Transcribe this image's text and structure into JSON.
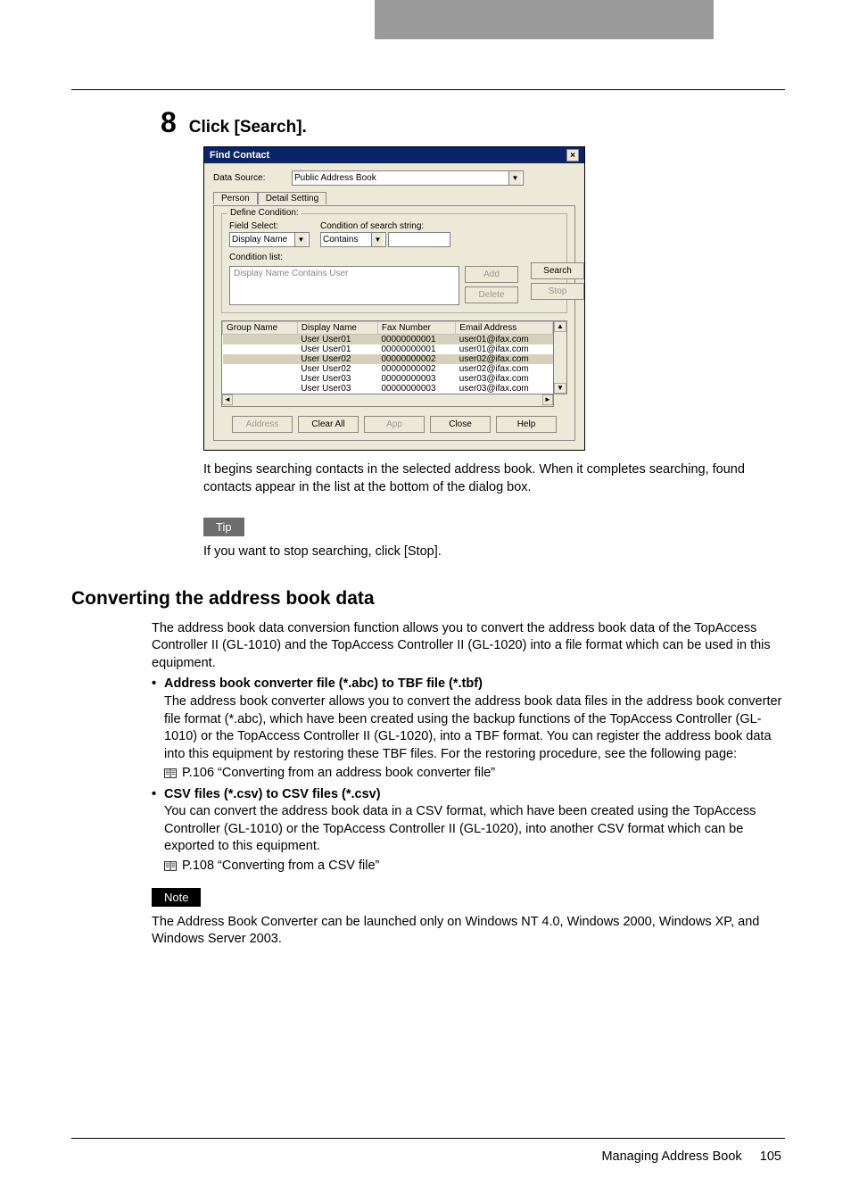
{
  "step": {
    "number": "8",
    "title": "Click [Search]."
  },
  "dialog": {
    "title": "Find Contact",
    "data_source_label": "Data Source:",
    "data_source_value": "Public Address Book",
    "tabs": {
      "person": "Person",
      "detail": "Detail Setting"
    },
    "fieldset_label": "Define Condition:",
    "field_select_label": "Field Select:",
    "field_select_value": "Display Name",
    "cond_label": "Condition of search string:",
    "cond_value": "Contains",
    "cond_list_label": "Condition list:",
    "cond_list_item": "Display Name Contains User",
    "buttons": {
      "add": "Add",
      "delete": "Delete",
      "search": "Search",
      "stop": "Stop",
      "address": "Address",
      "clear_all": "Clear All",
      "app": "App",
      "close": "Close",
      "help": "Help"
    },
    "columns": {
      "group": "Group Name",
      "display": "Display Name",
      "fax": "Fax Number",
      "email": "Email Address"
    },
    "rows": [
      {
        "display": "User User01",
        "fax": "00000000001",
        "email": "user01@ifax.com",
        "hl": true
      },
      {
        "display": "User User01",
        "fax": "00000000001",
        "email": "user01@ifax.com",
        "hl": false
      },
      {
        "display": "User User02",
        "fax": "00000000002",
        "email": "user02@ifax.com",
        "hl": true
      },
      {
        "display": "User User02",
        "fax": "00000000002",
        "email": "user02@ifax.com",
        "hl": false
      },
      {
        "display": "User User03",
        "fax": "00000000003",
        "email": "user03@ifax.com",
        "hl": false
      },
      {
        "display": "User User03",
        "fax": "00000000003",
        "email": "user03@ifax.com",
        "hl": false
      }
    ]
  },
  "after_screenshot": "It begins searching contacts in the selected address book. When it completes searching, found contacts appear in the list at the bottom of the dialog box.",
  "tip": {
    "label": "Tip",
    "text": "If you want to stop searching, click [Stop]."
  },
  "h2": "Converting the address book data",
  "section_intro": "The address book data conversion function allows you to convert the address book data of the TopAccess Controller II (GL-1010) and the TopAccess Controller II (GL-1020) into a file format which can be used in this equipment.",
  "bullets": [
    {
      "title": "Address book converter file (*.abc) to TBF file (*.tbf)",
      "body": "The address book converter allows you to convert the address book data files in the address book converter file format (*.abc), which have been created using the backup functions of the TopAccess Controller (GL-1010) or the TopAccess Controller II (GL-1020), into a TBF format. You can register the address book data into this equipment by restoring these TBF files. For the restoring procedure, see the following page:",
      "ref": "P.106 “Converting from an address book converter file”"
    },
    {
      "title": "CSV files (*.csv) to CSV files (*.csv)",
      "body": "You can convert the address book data in a CSV format, which have been created using the TopAccess Controller (GL-1010) or the TopAccess Controller II (GL-1020), into another CSV format which can be exported to this equipment.",
      "ref": "P.108 “Converting from a CSV file”"
    }
  ],
  "note": {
    "label": "Note",
    "text": "The Address Book Converter can be launched only on Windows NT 4.0, Windows 2000, Windows XP, and Windows Server 2003."
  },
  "footer": {
    "section": "Managing Address Book",
    "page": "105"
  }
}
